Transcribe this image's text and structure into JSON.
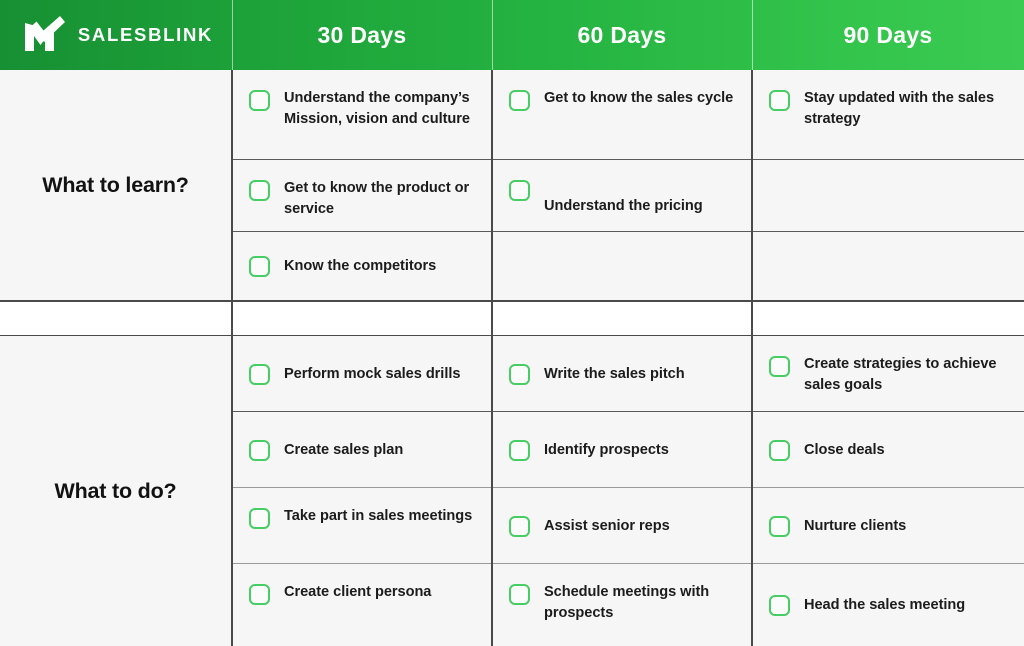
{
  "brand": {
    "name": "SALESBLINK",
    "logo_icon": "salesblink-checkmark-m-logo",
    "header_gradient_start": "#179033",
    "header_gradient_end": "#3bcb52",
    "checkbox_color": "#48cc64",
    "text_color": "#1c1c1c"
  },
  "header": {
    "columns": [
      {
        "label": "SALESBLINK",
        "is_logo": true
      },
      {
        "label": "30 Days",
        "is_logo": false
      },
      {
        "label": "60 Days",
        "is_logo": false
      },
      {
        "label": "90 Days",
        "is_logo": false
      }
    ]
  },
  "sections": [
    {
      "label": "What to learn?",
      "rows": [
        {
          "30": "Understand the company’s Mission, vision and culture",
          "60": "Get to know the sales cycle",
          "90": "Stay updated with the sales strategy"
        },
        {
          "30": "Get to know the product or service",
          "60": "Understand the pricing",
          "90": ""
        },
        {
          "30": "Know the competitors",
          "60": "",
          "90": ""
        }
      ]
    },
    {
      "label": "What to do?",
      "rows": [
        {
          "30": "Perform mock sales drills",
          "60": "Write the sales pitch",
          "90": "Create strategies to achieve sales goals"
        },
        {
          "30": "Create sales plan",
          "60": "Identify prospects",
          "90": "Close deals"
        },
        {
          "30": "Take part in sales meetings",
          "60": "Assist senior reps",
          "90": "Nurture clients"
        },
        {
          "30": "Create client persona",
          "60": "Schedule meetings with prospects",
          "90": "Head the sales meeting"
        }
      ]
    }
  ]
}
